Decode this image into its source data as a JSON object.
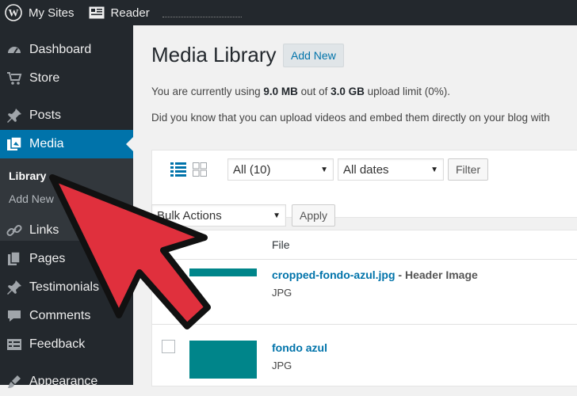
{
  "adminbar": {
    "my_sites": "My Sites",
    "reader": "Reader"
  },
  "sidebar": {
    "items": [
      {
        "label": "Dashboard",
        "icon": "dashboard-icon"
      },
      {
        "label": "Store",
        "icon": "cart-icon"
      },
      {
        "label": "Posts",
        "icon": "pin-icon"
      },
      {
        "label": "Media",
        "icon": "media-icon",
        "active": true
      },
      {
        "label": "Links",
        "icon": "link-icon"
      },
      {
        "label": "Pages",
        "icon": "pages-icon"
      },
      {
        "label": "Testimonials",
        "icon": "pin-icon"
      },
      {
        "label": "Comments",
        "icon": "comment-icon"
      },
      {
        "label": "Feedback",
        "icon": "feedback-icon"
      },
      {
        "label": "Appearance",
        "icon": "brush-icon"
      }
    ],
    "submenu": [
      {
        "label": "Library",
        "current": true
      },
      {
        "label": "Add New"
      }
    ]
  },
  "main": {
    "title": "Media Library",
    "add_new": "Add New",
    "notice_pre": "You are currently using ",
    "used": "9.0 MB",
    "notice_mid": " out of ",
    "limit": "3.0 GB",
    "notice_post": " upload limit (0%).",
    "tip": "Did you know that you can upload videos and embed them directly on your blog with"
  },
  "toolbar": {
    "filter_type": "All (10)",
    "filter_date": "All dates",
    "filter_button": "Filter",
    "bulk_actions": "Bulk Actions",
    "apply_button": "Apply"
  },
  "table": {
    "column_file": "File",
    "rows": [
      {
        "title": "cropped-fondo-azul.jpg",
        "desc": " - Header Image",
        "type": "JPG"
      },
      {
        "title": "fondo azul",
        "desc": "",
        "type": "JPG"
      }
    ]
  },
  "colors": {
    "admin_bg": "#23282d",
    "accent": "#0073aa",
    "thumb": "#00858a",
    "arrow": "#e0303d"
  }
}
